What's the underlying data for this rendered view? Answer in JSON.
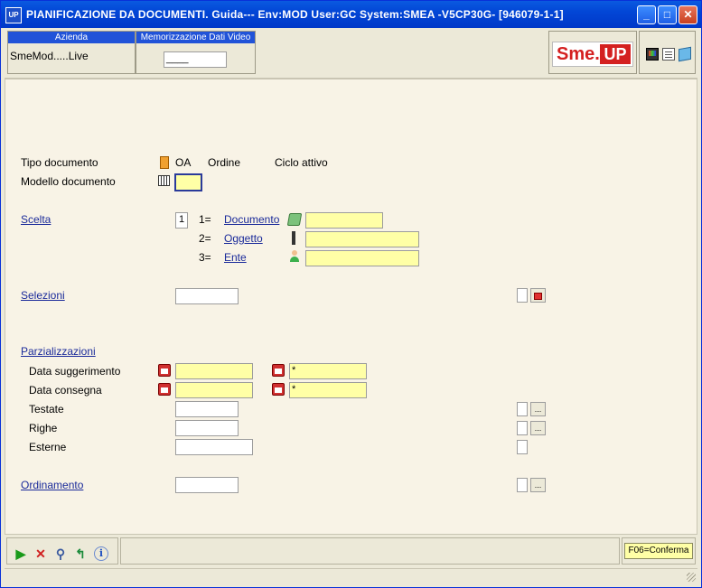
{
  "window": {
    "title": "PIANIFICAZIONE DA DOCUMENTI.  Guida--- Env:MOD User:GC System:SMEA -V5CP30G- [946079-1-1]",
    "app_icon": "UP",
    "minimize": "_",
    "maximize": "□",
    "close": "✕"
  },
  "header": {
    "azienda_label": "Azienda",
    "azienda_value": "SmeMod.....Live",
    "memo_label": "Memorizzazione Dati Video",
    "memo_value": "____",
    "logo_left": "Sme.",
    "logo_right": "UP"
  },
  "form": {
    "tipo_label": "Tipo documento",
    "tipo_code": "OA",
    "tipo_desc": "Ordine",
    "tipo_ciclo": "Ciclo attivo",
    "modello_label": "Modello documento",
    "scelta_label": "Scelta",
    "scelta_value": "1",
    "opt1_num": "1=",
    "opt1_label": "Documento",
    "opt2_num": "2=",
    "opt2_label": "Oggetto",
    "opt3_num": "3=",
    "opt3_label": "Ente",
    "selezioni_label": "Selezioni",
    "parz_label": "Parzializzazioni",
    "data_sugg_label": "Data suggerimento",
    "data_sugg_to": "*",
    "data_cons_label": "Data consegna",
    "data_cons_to": "*",
    "testate_label": "Testate",
    "righe_label": "Righe",
    "esterne_label": "Esterne",
    "ordinamento_label": "Ordinamento",
    "dots": "..."
  },
  "footer": {
    "f06": "F06=Conferma"
  },
  "colors": {
    "title_bar": "#0246d6",
    "input_yellow": "#ffffa6",
    "link": "#1a2a9a",
    "logo_red": "#d42020"
  }
}
